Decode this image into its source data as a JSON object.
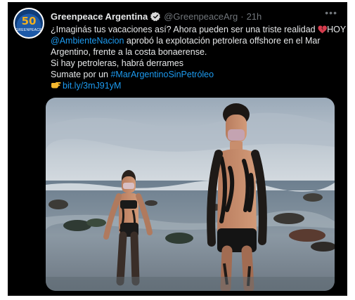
{
  "author": {
    "name": "Greenpeace Argentina",
    "handle": "@GreenpeaceArg",
    "separator": "·",
    "time": "21h",
    "avatar_number": "50",
    "avatar_subtext": "GREENPEACE"
  },
  "tweet": {
    "line1": "¿Imaginás tus vacaciones así? Ahora pueden ser una triste realidad ",
    "line1_end": "HOY",
    "mention": "@AmbienteNacion",
    "line2_rest": " aprobó la explotación petrolera offshore en el Mar",
    "line3": "Argentino, frente a la costa bonaerense.",
    "line4": "Si hay petroleras, habrá derrames",
    "line5_prefix": "Sumate por un ",
    "hashtag": "#MarArgentinoSinPetróleo",
    "link": "bit.ly/3mJ91yM"
  },
  "icons": {
    "verified": "verified-badge-icon",
    "broken_heart": "broken-heart-icon",
    "pointing_hand": "pointing-hand-icon",
    "more": "more-options-icon"
  },
  "colors": {
    "background": "#000000",
    "text": "#e7e9ea",
    "secondary": "#71767b",
    "link": "#1d9bf0",
    "heart": "#d63d4e"
  }
}
